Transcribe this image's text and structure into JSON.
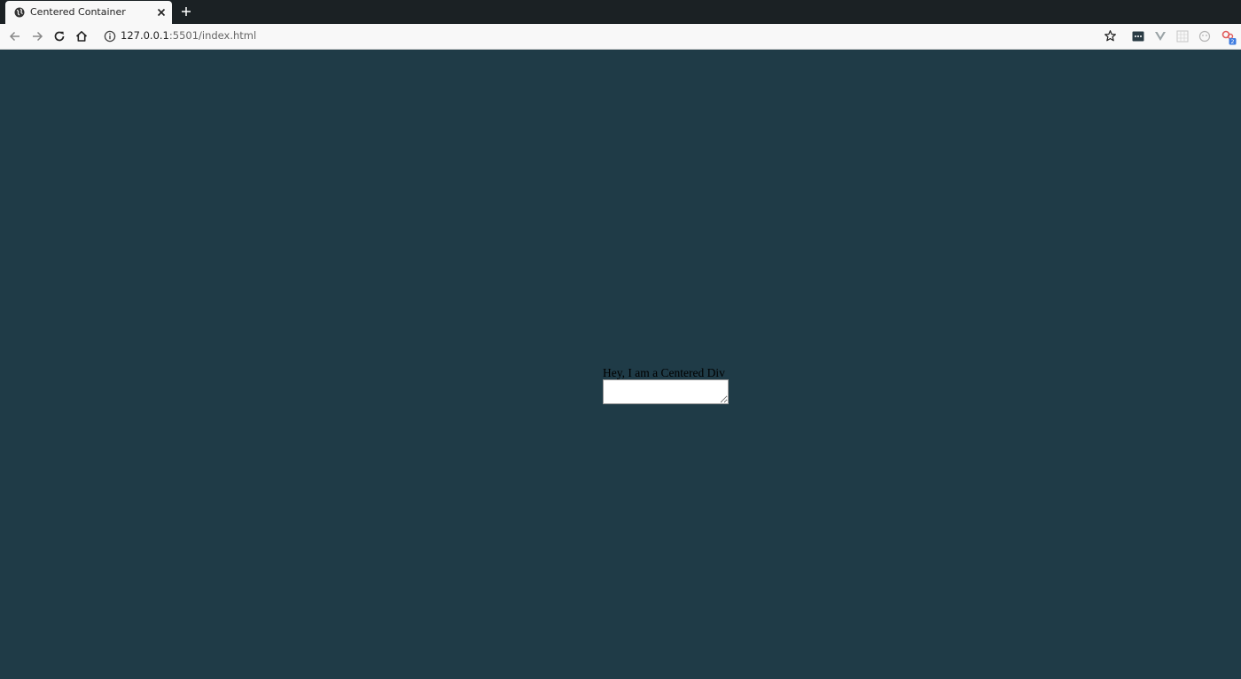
{
  "browser": {
    "tab": {
      "title": "Centered Container"
    },
    "address_bar": {
      "host": "127.0.0.1",
      "path": ":5501/index.html"
    },
    "icons": {
      "favicon": "globe-icon",
      "close": "close-icon",
      "new_tab": "plus-icon",
      "back": "back-arrow-icon",
      "forward": "forward-arrow-icon",
      "reload": "reload-icon",
      "home": "home-icon",
      "info": "info-icon",
      "bookmark": "star-icon"
    }
  },
  "page": {
    "background_color": "#1f3b47",
    "centered_div": {
      "text": "Hey, I am a Centered Div",
      "textarea_value": ""
    }
  }
}
